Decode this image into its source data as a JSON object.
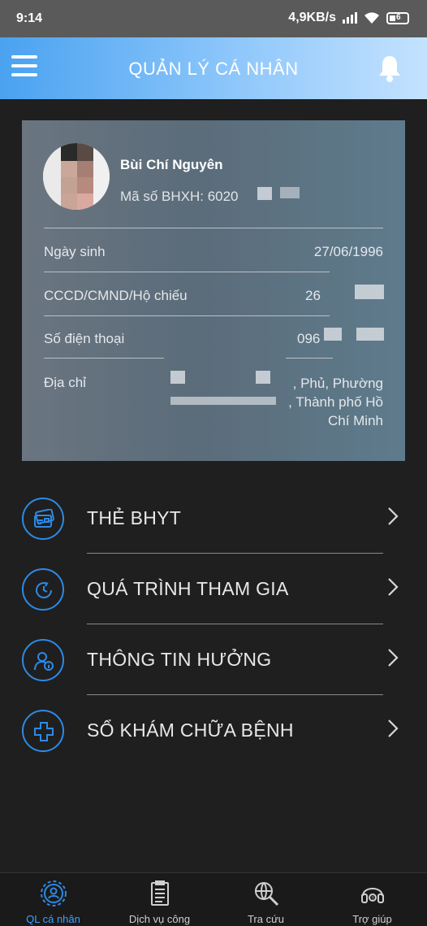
{
  "status_bar": {
    "time": "9:14",
    "speed": "4,9KB/s",
    "battery": "6"
  },
  "header": {
    "title": "QUẢN LÝ CÁ NHÂN",
    "menu_icon": "hamburger-icon",
    "bell_icon": "bell-icon"
  },
  "profile": {
    "name": "Bùi Chí Nguyên",
    "bhxh": "Mã số BHXH: 6020",
    "rows": [
      {
        "label": "Ngày sinh",
        "value": "27/06/1996"
      },
      {
        "label": "CCCD/CMND/Hộ chiếu",
        "value": "26"
      },
      {
        "label": "Số điện thoại",
        "value": "096"
      },
      {
        "label": "Địa chỉ",
        "value": ", Phủ, Phường\n, Thành phố Hồ\nChí Minh"
      }
    ]
  },
  "menu": [
    {
      "label": "THẺ BHYT",
      "icon": "health-card-icon"
    },
    {
      "label": "QUÁ TRÌNH THAM GIA",
      "icon": "history-icon"
    },
    {
      "label": "THÔNG TIN HƯỞNG",
      "icon": "user-info-icon"
    },
    {
      "label": "SỔ KHÁM CHỮA BỆNH",
      "icon": "medical-cross-icon"
    }
  ],
  "bottom_nav": [
    {
      "label": "QL cá nhân",
      "icon": "personal-gear-icon",
      "active": true
    },
    {
      "label": "Dịch vụ công",
      "icon": "clipboard-icon",
      "active": false
    },
    {
      "label": "Tra cứu",
      "icon": "globe-search-icon",
      "active": false
    },
    {
      "label": "Trợ giúp",
      "icon": "headset-icon",
      "active": false
    }
  ],
  "colors": {
    "accent": "#2d8ae5",
    "header_start": "#4aa2f0",
    "header_end": "#c4e2ff",
    "background": "#1f1f1f"
  }
}
